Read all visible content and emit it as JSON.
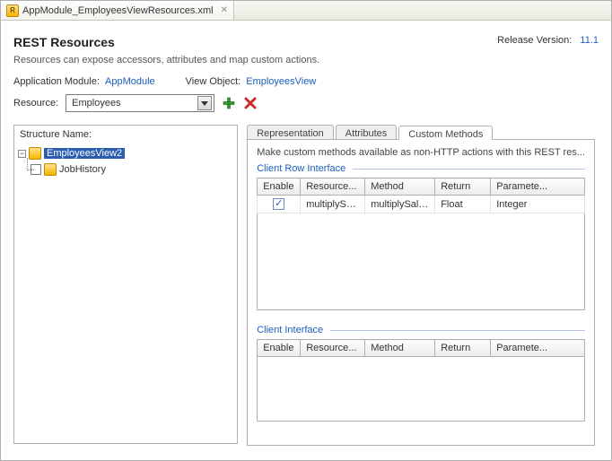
{
  "tab": {
    "filename": "AppModule_EmployeesViewResources.xml"
  },
  "header": {
    "title": "REST Resources",
    "release_label": "Release Version:",
    "release_value": "11.1",
    "description": "Resources can expose accessors, attributes and map custom actions."
  },
  "module_row": {
    "app_module_label": "Application Module:",
    "app_module_link": "AppModule",
    "view_object_label": "View Object:",
    "view_object_link": "EmployeesView"
  },
  "resource_row": {
    "label": "Resource:",
    "selected": "Employees"
  },
  "structure": {
    "title": "Structure Name:",
    "root": "EmployeesView2",
    "child": "JobHistory"
  },
  "rtabs": {
    "representation": "Representation",
    "attributes": "Attributes",
    "custom_methods": "Custom Methods"
  },
  "custom_methods": {
    "hint": "Make custom methods available as non-HTTP actions with this REST res...",
    "client_row_interface": "Client Row Interface",
    "client_interface": "Client Interface",
    "columns": {
      "enable": "Enable",
      "resource": "Resource...",
      "method": "Method",
      "return": "Return",
      "parameters": "Paramete..."
    },
    "rows": [
      {
        "enabled": true,
        "resource": "multiplySalary",
        "method": "multiplySalary",
        "return": "Float",
        "parameters": "Integer"
      }
    ]
  }
}
